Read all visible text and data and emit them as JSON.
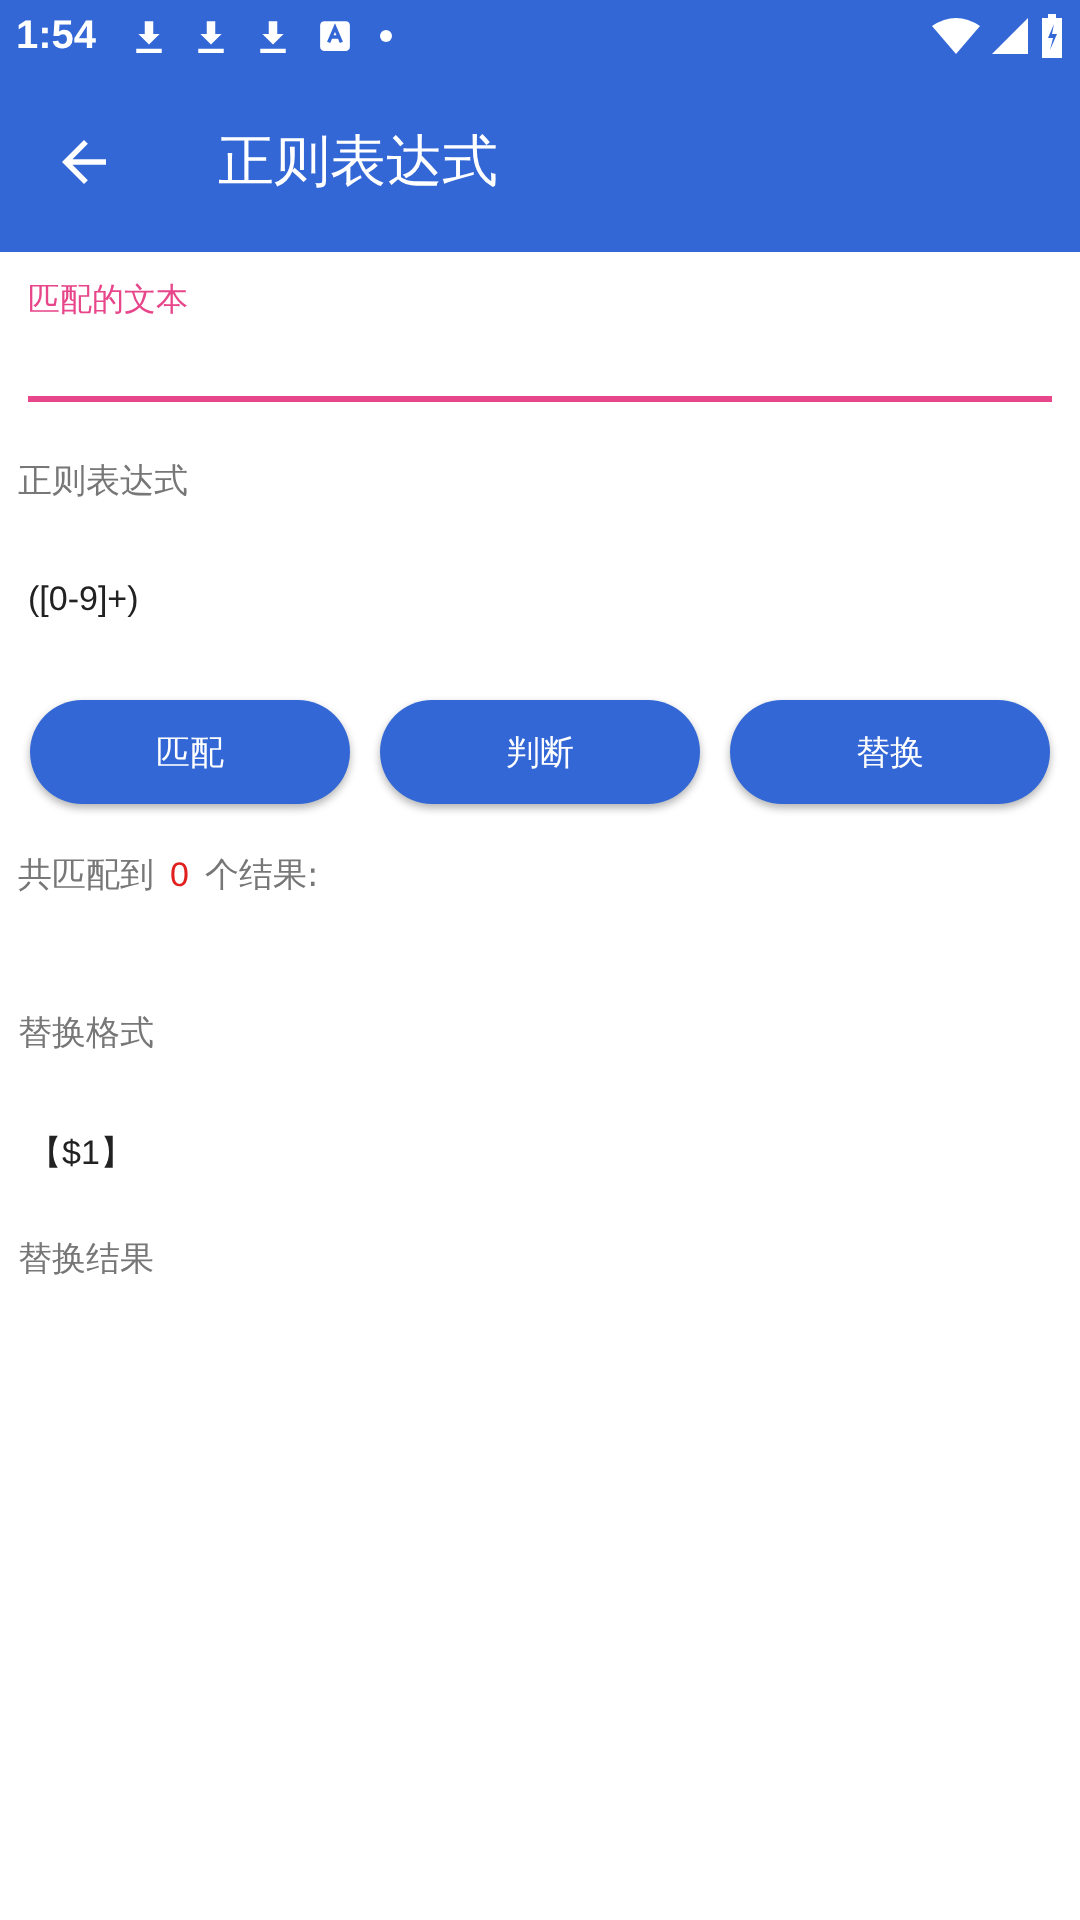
{
  "status_bar": {
    "time": "1:54"
  },
  "app_bar": {
    "title": "正则表达式"
  },
  "match_text": {
    "label": "匹配的文本",
    "focused": true
  },
  "regex": {
    "label": "正则表达式",
    "value": "([0-9]+)"
  },
  "buttons": [
    "匹配",
    "判断",
    "替换"
  ],
  "result_count": {
    "prefix": "共匹配到",
    "count": "0",
    "suffix": "个结果:"
  },
  "replace_format": {
    "label": "替换格式",
    "value": "【$1】"
  },
  "replace_result": {
    "label": "替换结果"
  }
}
